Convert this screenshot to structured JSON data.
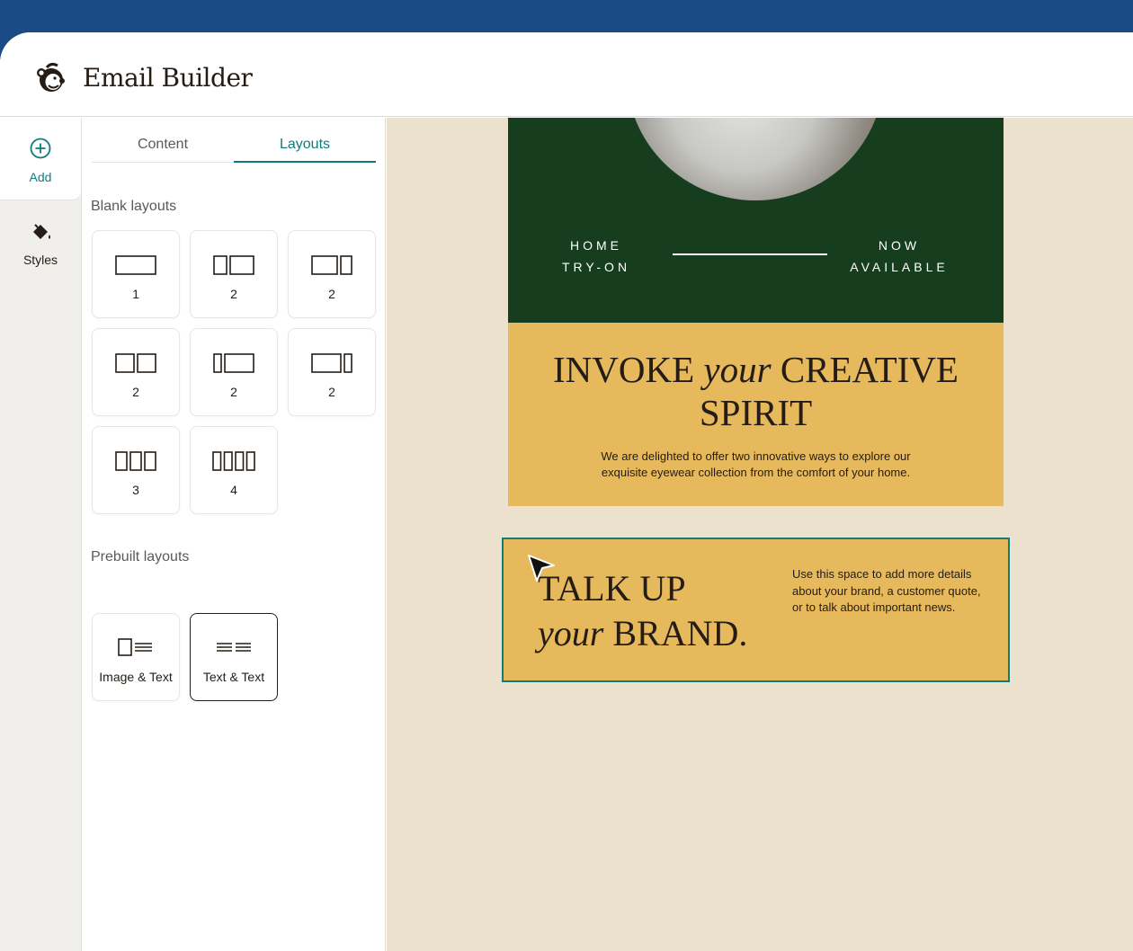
{
  "app": {
    "title": "Email Builder"
  },
  "colors": {
    "header_bg": "#1b4b86",
    "accent": "#0f7c7b",
    "canvas_bg": "#ebe1cc",
    "hero_green": "#173d1f",
    "mustard": "#e6b95d"
  },
  "rail": {
    "items": [
      {
        "label": "Add",
        "icon": "plus-circle-icon"
      },
      {
        "label": "Styles",
        "icon": "paint-bucket-icon"
      }
    ]
  },
  "panel": {
    "tabs": [
      {
        "label": "Content"
      },
      {
        "label": "Layouts"
      }
    ],
    "active_tab": "Layouts",
    "blank_label": "Blank layouts",
    "blank_layouts": [
      {
        "label": "1",
        "icon": "one-column-layout-icon"
      },
      {
        "label": "2",
        "icon": "two-column-equal-layout-icon"
      },
      {
        "label": "2",
        "icon": "two-column-wide-left-layout-icon"
      },
      {
        "label": "2",
        "icon": "two-column-equal-layout-icon"
      },
      {
        "label": "2",
        "icon": "two-column-narrow-left-layout-icon"
      },
      {
        "label": "2",
        "icon": "two-column-narrow-right-layout-icon"
      },
      {
        "label": "3",
        "icon": "three-column-layout-icon"
      },
      {
        "label": "4",
        "icon": "four-column-layout-icon"
      }
    ],
    "prebuilt_label": "Prebuilt layouts",
    "prebuilt_layouts": [
      {
        "label": "Image & Text",
        "icon": "image-text-layout-icon"
      },
      {
        "label": "Text & Text",
        "icon": "text-text-layout-icon",
        "selected": true
      }
    ]
  },
  "email": {
    "hero": {
      "left_text_1": "HOME",
      "left_text_2": "TRY-ON",
      "right_text_1": "NOW",
      "right_text_2": "AVAILABLE"
    },
    "intro": {
      "headline_a": "INVOKE",
      "headline_italic": "your",
      "headline_b": "CREATIVE",
      "headline_c": "SPIRIT",
      "body_1": "We are delighted to offer two innovative ways to explore our",
      "body_2": "exquisite eyewear collection from the comfort of your home."
    },
    "block": {
      "heading_1": "TALK UP",
      "heading_italic": "your",
      "heading_2": "BRAND.",
      "body": "Use this space to add more details about your brand, a customer quote, or to talk about important news."
    }
  }
}
